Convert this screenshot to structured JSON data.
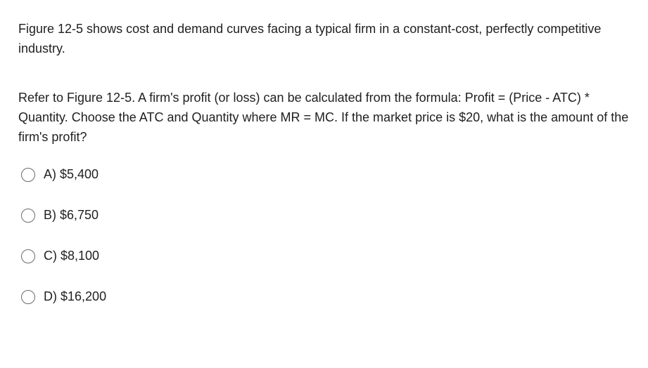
{
  "context": "Figure 12-5 shows cost and demand curves facing a typical firm in a constant-cost, perfectly competitive industry.",
  "question": "Refer to Figure 12-5. A firm's profit (or loss) can be calculated from the formula: Profit = (Price - ATC) * Quantity. Choose the ATC and Quantity where MR = MC. If the market price is $20, what is the amount of the firm's profit?",
  "options": [
    {
      "letter": "A)",
      "text": "$5,400"
    },
    {
      "letter": "B)",
      "text": "$6,750"
    },
    {
      "letter": "C)",
      "text": "$8,100"
    },
    {
      "letter": "D)",
      "text": "$16,200"
    }
  ]
}
